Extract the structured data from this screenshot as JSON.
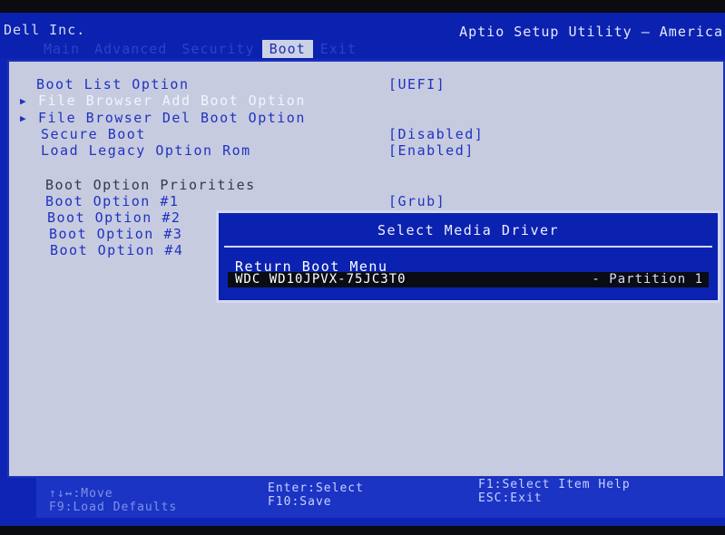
{
  "header": {
    "vendor": "Dell Inc.",
    "utility_title": "Aptio Setup Utility – America",
    "tabs": [
      "Main",
      "Advanced",
      "Security",
      "Boot",
      "Exit"
    ],
    "active_tab": "Boot"
  },
  "boot_menu": {
    "boot_list_option": {
      "label": "Boot List Option",
      "value": "[UEFI]"
    },
    "file_browser_add": {
      "label": "File Browser Add Boot Option"
    },
    "file_browser_del": {
      "label": "File Browser Del Boot Option"
    },
    "secure_boot": {
      "label": "Secure Boot",
      "value": "[Disabled]"
    },
    "load_legacy": {
      "label": "Load Legacy Option Rom",
      "value": "[Enabled]"
    },
    "priorities_heading": "Boot Option Priorities",
    "boot_options": [
      {
        "label": "Boot Option #1",
        "value": "[Grub]"
      },
      {
        "label": "Boot Option #2"
      },
      {
        "label": "Boot Option #3"
      },
      {
        "label": "Boot Option #4"
      }
    ]
  },
  "dialog": {
    "title": "Select Media Driver",
    "items": [
      {
        "label": "Return Boot Menu"
      },
      {
        "label": "WDC WD10JPVX-75JC3T0",
        "suffix": "- Partition 1",
        "selected": true
      }
    ]
  },
  "footer": {
    "move": "↑↓↔:Move",
    "load_defaults": "F9:Load Defaults",
    "select": "Enter:Select",
    "save": "F10:Save",
    "help": "F1:Select Item Help",
    "exit": "ESC:Exit"
  },
  "colors": {
    "bios_blue": "#0d24b4",
    "panel_gray": "#c7cbe0",
    "option_text": "#1f33c0",
    "selection_bg": "#0a0c14"
  }
}
